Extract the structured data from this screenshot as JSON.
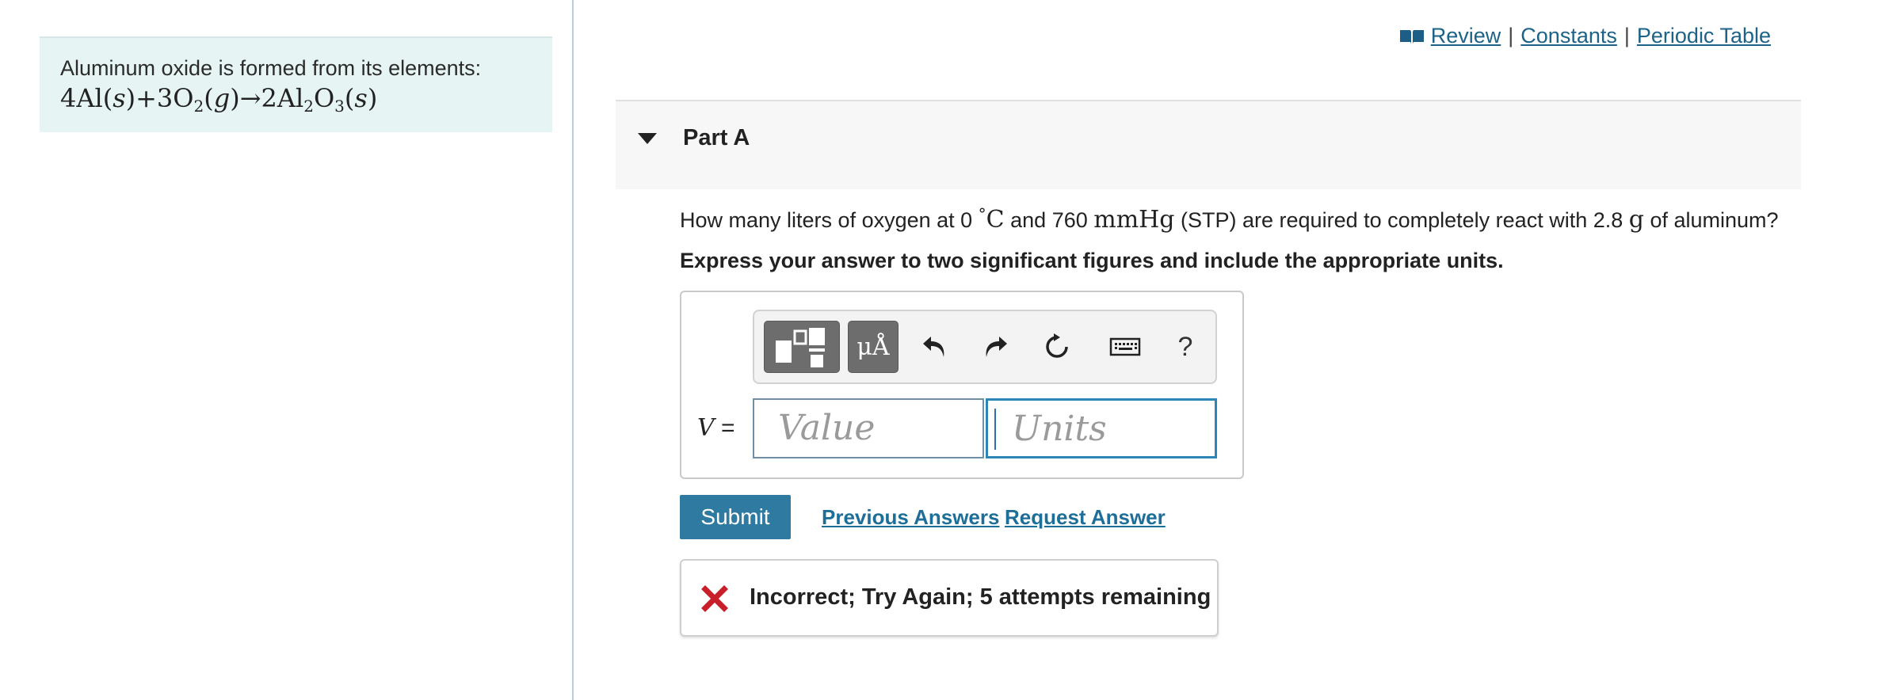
{
  "left_panel": {
    "intro_text": "Aluminum oxide is formed from its elements:",
    "equation": {
      "t1": "4Al(",
      "t2": "s",
      "t3": ")+3O",
      "t4": "2",
      "t5": "(",
      "t6": "g",
      "t7": ")→2Al",
      "t8": "2",
      "t9": "O",
      "t10": "3",
      "t11": "(",
      "t12": "s",
      "t13": ")"
    }
  },
  "top_links": {
    "review": "Review",
    "separator": "|",
    "constants": "Constants",
    "periodic_table": "Periodic Table"
  },
  "part": {
    "title": "Part A"
  },
  "question": {
    "q1": "How many liters of oxygen at 0 ",
    "deg": "°",
    "unitC": "C",
    "q2": " and 760 ",
    "mmhg": "mmHg",
    "q3": " (STP) are required to completely react with 2.8 ",
    "g": "g",
    "q4": " of aluminum?",
    "instruction": "Express your answer to two significant figures and include the appropriate units."
  },
  "answer": {
    "variable": "V",
    "equals": " =",
    "value_placeholder": "Value",
    "units_placeholder": "Units",
    "units_button": "μÅ",
    "help_button": "?"
  },
  "actions": {
    "submit": "Submit",
    "previous_answers": "Previous Answers",
    "request_answer": "Request Answer"
  },
  "feedback": {
    "message": "Incorrect; Try Again; 5 attempts remaining",
    "status_color": "#c8202a"
  },
  "colors": {
    "accent": "#2f7aa0",
    "link": "#1d6289",
    "intro_bg": "#e7f4f4"
  }
}
